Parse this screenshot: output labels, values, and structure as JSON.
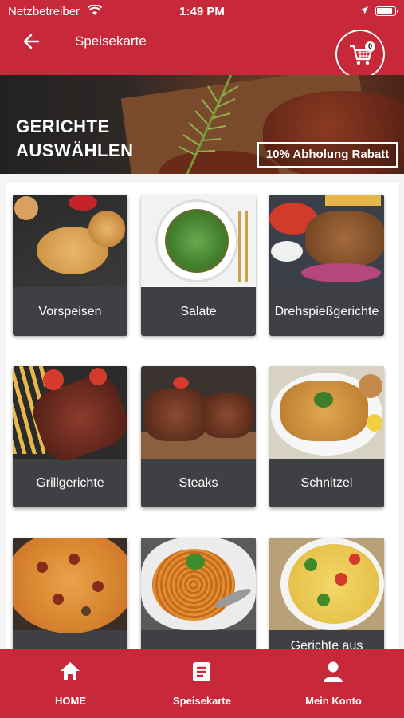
{
  "status_bar": {
    "carrier": "Netzbetreiber",
    "time": "1:49 PM"
  },
  "header": {
    "title": "Speisekarte",
    "cart_count": "0"
  },
  "banner": {
    "headline_line1": "GERICHTE",
    "headline_line2": "AUSWÄHLEN",
    "promo": "10% Abholung Rabatt"
  },
  "categories": [
    {
      "label": "Vorspeisen",
      "icon": "pizza-bread-image"
    },
    {
      "label": "Salate",
      "icon": "salad-image"
    },
    {
      "label": "Drehspießgerichte",
      "icon": "doner-image"
    },
    {
      "label": "Grillgerichte",
      "icon": "grilled-meat-image"
    },
    {
      "label": "Steaks",
      "icon": "steak-image"
    },
    {
      "label": "Schnitzel",
      "icon": "schnitzel-image"
    },
    {
      "label": "",
      "icon": "pizza-image"
    },
    {
      "label": "",
      "icon": "spaghetti-image"
    },
    {
      "label": "Gerichte aus",
      "icon": "casserole-image"
    }
  ],
  "bottom_nav": [
    {
      "label": "HOME",
      "icon": "home-icon"
    },
    {
      "label": "Speisekarte",
      "icon": "menu-icon"
    },
    {
      "label": "Mein Konto",
      "icon": "user-icon"
    }
  ],
  "colors": {
    "brand_red": "#c7283a",
    "card_dark": "#3e4043"
  }
}
